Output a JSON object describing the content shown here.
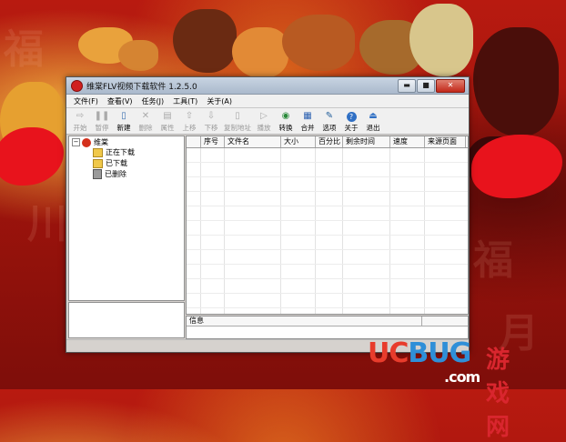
{
  "window": {
    "title": "维棠FLV视频下载软件 1.2.5.0",
    "controls": {
      "minimize": "▬",
      "maximize": "■",
      "close": "✕"
    }
  },
  "menu": [
    "文件(F)",
    "查看(V)",
    "任务(J)",
    "工具(T)",
    "关于(A)"
  ],
  "toolbar": [
    {
      "label": "开始",
      "icon": "play-icon",
      "glyph": "⇨",
      "enabled": false
    },
    {
      "label": "暂停",
      "icon": "pause-icon",
      "glyph": "❚❚",
      "enabled": false
    },
    {
      "label": "新建",
      "icon": "new-file-icon",
      "glyph": "▯",
      "enabled": true
    },
    {
      "label": "删除",
      "icon": "delete-icon",
      "glyph": "✕",
      "enabled": false
    },
    {
      "label": "属性",
      "icon": "properties-icon",
      "glyph": "▤",
      "enabled": false
    },
    {
      "label": "上移",
      "icon": "move-up-icon",
      "glyph": "⇧",
      "enabled": false
    },
    {
      "label": "下移",
      "icon": "move-down-icon",
      "glyph": "⇩",
      "enabled": false
    },
    {
      "label": "复制地址",
      "icon": "copy-address-icon",
      "glyph": "▯",
      "enabled": false
    },
    {
      "label": "播放",
      "icon": "media-play-icon",
      "glyph": "▷",
      "enabled": false
    },
    {
      "label": "转换",
      "icon": "convert-icon",
      "glyph": "◉",
      "enabled": true
    },
    {
      "label": "合并",
      "icon": "merge-icon",
      "glyph": "▦",
      "enabled": true
    },
    {
      "label": "选项",
      "icon": "options-icon",
      "glyph": "✎",
      "enabled": true
    },
    {
      "label": "关于",
      "icon": "about-icon",
      "glyph": "?",
      "enabled": true
    },
    {
      "label": "退出",
      "icon": "exit-icon",
      "glyph": "⏏",
      "enabled": true
    }
  ],
  "tree": {
    "root": "维棠",
    "children": [
      "正在下载",
      "已下载",
      "已删除"
    ]
  },
  "list_columns": [
    "序号",
    "文件名",
    "大小",
    "百分比",
    "剩余时间",
    "速度",
    "来源页面"
  ],
  "info_label": "信息",
  "watermark": {
    "uc": "UC",
    "bug": "BUG",
    "cn": "游戏网",
    "com": ".com"
  },
  "colors": {
    "title_bar": "#aab9cc",
    "close_button": "#c2281a",
    "background": "#a0140c"
  }
}
